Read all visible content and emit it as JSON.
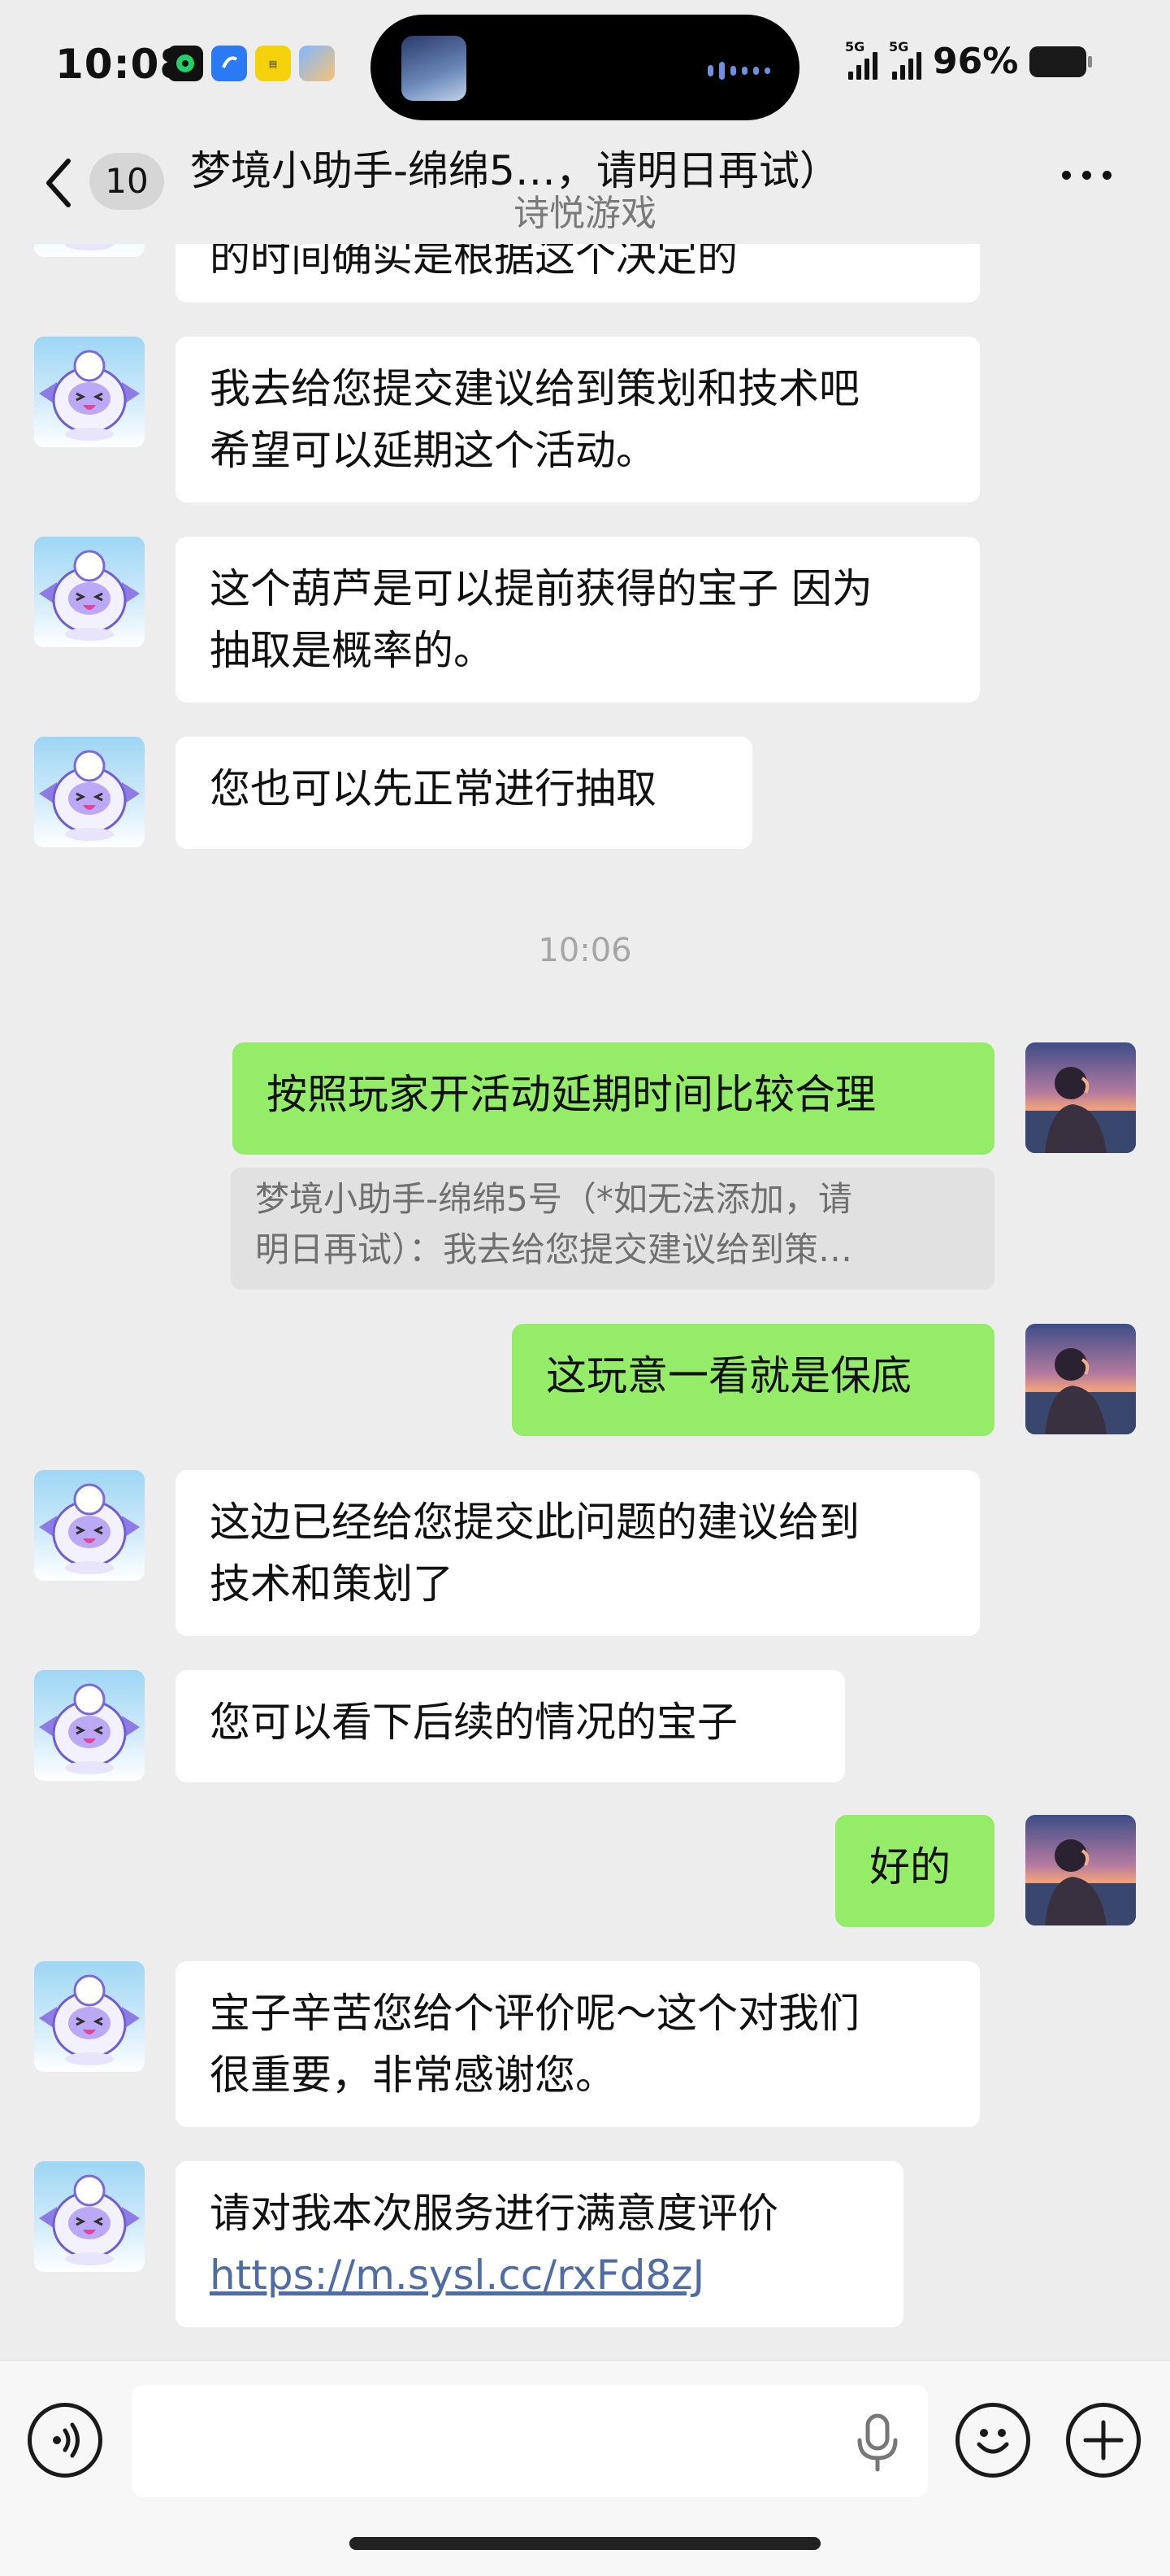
{
  "status_bar": {
    "time": "10:08",
    "signal1_label": "5G",
    "signal2_label": "5G",
    "battery_percent": "96%"
  },
  "header": {
    "back_count": "10",
    "title": "梦境小助手-绵绵5…，请明日再试）",
    "subtitle": "诗悦游戏"
  },
  "messages": [
    {
      "id": "m0",
      "sender": "bot",
      "lines": [
        "的时间确实是根据这个决定的"
      ]
    },
    {
      "id": "m1",
      "sender": "bot",
      "lines": [
        "我去给您提交建议给到策划和技术吧",
        "希望可以延期这个活动。"
      ]
    },
    {
      "id": "m2",
      "sender": "bot",
      "lines": [
        "这个葫芦是可以提前获得的宝子 因为",
        "抽取是概率的。"
      ]
    },
    {
      "id": "m3",
      "sender": "bot",
      "lines": [
        "您也可以先正常进行抽取"
      ]
    },
    {
      "id": "t1",
      "type": "timestamp",
      "text": "10:06"
    },
    {
      "id": "m4",
      "sender": "user",
      "lines": [
        "按照玩家开活动延期时间比较合理"
      ],
      "quote": [
        "梦境小助手-绵绵5号（*如无法添加，请",
        "明日再试）：我去给您提交建议给到策…"
      ]
    },
    {
      "id": "m5",
      "sender": "user",
      "lines": [
        "这玩意一看就是保底"
      ]
    },
    {
      "id": "m6",
      "sender": "bot",
      "lines": [
        "这边已经给您提交此问题的建议给到",
        "技术和策划了"
      ]
    },
    {
      "id": "m7",
      "sender": "bot",
      "lines": [
        "您可以看下后续的情况的宝子"
      ]
    },
    {
      "id": "m8",
      "sender": "user",
      "lines": [
        "好的"
      ]
    },
    {
      "id": "m9",
      "sender": "bot",
      "lines": [
        "宝子辛苦您给个评价呢～这个对我们",
        "很重要，非常感谢您。"
      ]
    },
    {
      "id": "m10",
      "sender": "bot",
      "lines": [
        "请对我本次服务进行满意度评价"
      ],
      "link": "https://m.sysl.cc/rxFd8zJ"
    }
  ],
  "input": {
    "value": "",
    "placeholder": ""
  },
  "icons": {
    "back": "chevron-left-icon",
    "more": "more-dots-icon",
    "voice": "voice-icon",
    "mic": "microphone-icon",
    "emoji": "emoji-icon",
    "plus": "plus-icon"
  },
  "colors": {
    "background": "#ededed",
    "user_bubble": "#95ec69",
    "bot_bubble": "#ffffff",
    "link": "#4f6da4"
  }
}
